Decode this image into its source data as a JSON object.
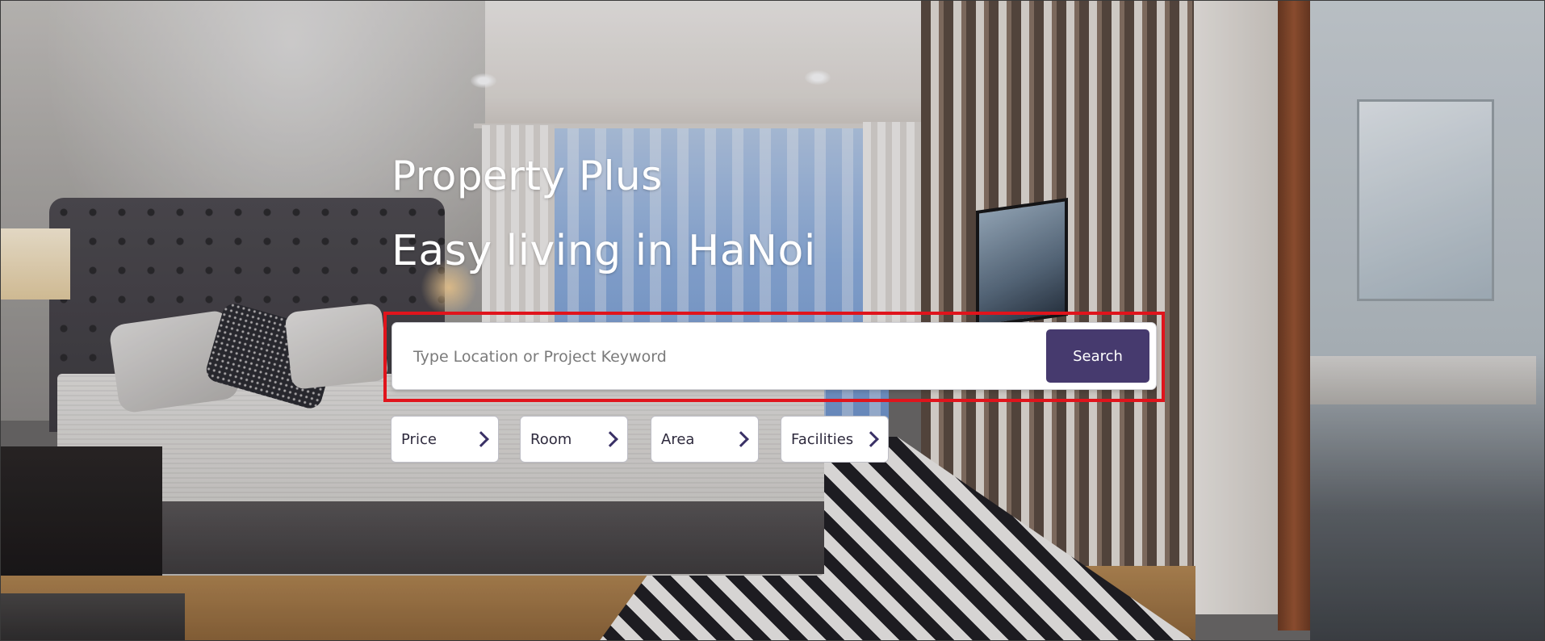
{
  "hero": {
    "title_line1": "Property Plus",
    "title_line2": "Easy living in HaNoi"
  },
  "search": {
    "placeholder": "Type Location or Project Keyword",
    "value": "",
    "button_label": "Search",
    "button_color": "#463a6e",
    "highlight_color": "#e0141c"
  },
  "filters": [
    {
      "label": "Price",
      "icon": "chevron-right-icon"
    },
    {
      "label": "Room",
      "icon": "chevron-right-icon"
    },
    {
      "label": "Area",
      "icon": "chevron-right-icon"
    },
    {
      "label": "Facilities",
      "icon": "chevron-right-icon"
    }
  ]
}
